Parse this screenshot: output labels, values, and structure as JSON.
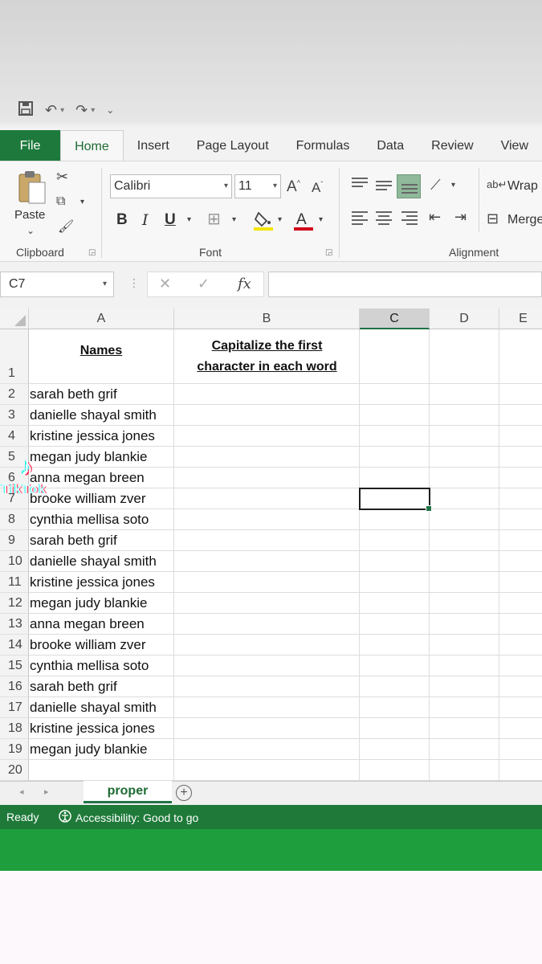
{
  "tabs": [
    "File",
    "Home",
    "Insert",
    "Page Layout",
    "Formulas",
    "Data",
    "Review",
    "View"
  ],
  "ribbon": {
    "paste_label": "Paste",
    "clipboard_label": "Clipboard",
    "font_name": "Calibri",
    "font_size": "11",
    "font_label": "Font",
    "alignment_label": "Alignment",
    "wrap_label": "Wrap",
    "merge_label": "Merge",
    "bold": "B",
    "italic": "I",
    "underline": "U"
  },
  "formula_bar": {
    "name_box": "C7",
    "fx": "fx",
    "value": ""
  },
  "columns": [
    "A",
    "B",
    "C",
    "D",
    "E"
  ],
  "selected_column": "C",
  "header_row": {
    "a": "Names",
    "b_line1": "Capitalize the first",
    "b_line2": "character in each word"
  },
  "rows": [
    {
      "num": "1",
      "a": ""
    },
    {
      "num": "2",
      "a": "sarah beth grif"
    },
    {
      "num": "3",
      "a": "danielle shayal smith"
    },
    {
      "num": "4",
      "a": "kristine jessica jones"
    },
    {
      "num": "5",
      "a": "megan judy blankie"
    },
    {
      "num": "6",
      "a": "anna megan breen"
    },
    {
      "num": "7",
      "a": "brooke william zver"
    },
    {
      "num": "8",
      "a": "cynthia mellisa soto"
    },
    {
      "num": "9",
      "a": "sarah beth grif"
    },
    {
      "num": "10",
      "a": "danielle shayal smith"
    },
    {
      "num": "11",
      "a": "kristine jessica jones"
    },
    {
      "num": "12",
      "a": "megan judy blankie"
    },
    {
      "num": "13",
      "a": "anna megan breen"
    },
    {
      "num": "14",
      "a": "brooke william zver"
    },
    {
      "num": "15",
      "a": "cynthia mellisa soto"
    },
    {
      "num": "16",
      "a": "sarah beth grif"
    },
    {
      "num": "17",
      "a": "danielle shayal smith"
    },
    {
      "num": "18",
      "a": "kristine jessica jones"
    },
    {
      "num": "19",
      "a": "megan judy blankie"
    },
    {
      "num": "20",
      "a": ""
    }
  ],
  "sheet_tab": "proper",
  "status": {
    "ready": "Ready",
    "accessibility": "Accessibility: Good to go"
  },
  "watermark": "TikTok",
  "colors": {
    "excel_green": "#217346",
    "status_green": "#1f7a3a",
    "band_green": "#1e9e3c"
  }
}
